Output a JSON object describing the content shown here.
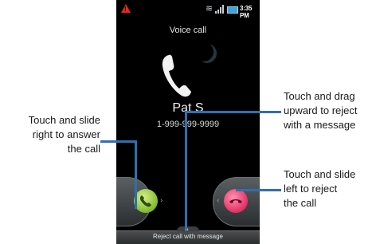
{
  "status_bar": {
    "time": "3:35 PM",
    "warning_icon": "warning-icon",
    "wifi_icon": "wifi-icon",
    "signal_icon": "signal-icon",
    "battery_icon": "battery-icon"
  },
  "screen": {
    "title": "Voice call",
    "caller_name": "Pat S",
    "caller_number": "1-999-999-9999",
    "accept_icon": "phone-answer-icon",
    "reject_icon": "phone-hangup-icon",
    "reject_with_message": "Reject call with message"
  },
  "callouts": {
    "answer": [
      "Touch and slide",
      "right to answer",
      "the call"
    ],
    "reject_message": [
      "Touch and drag",
      "upward to reject",
      "with a message"
    ],
    "reject": [
      "Touch and slide",
      "left to reject",
      "the call"
    ]
  },
  "colors": {
    "accent_line": "#2f6fb2",
    "accept": "#8fc33a",
    "reject": "#ea3d6d",
    "warning": "#e52a1e"
  }
}
